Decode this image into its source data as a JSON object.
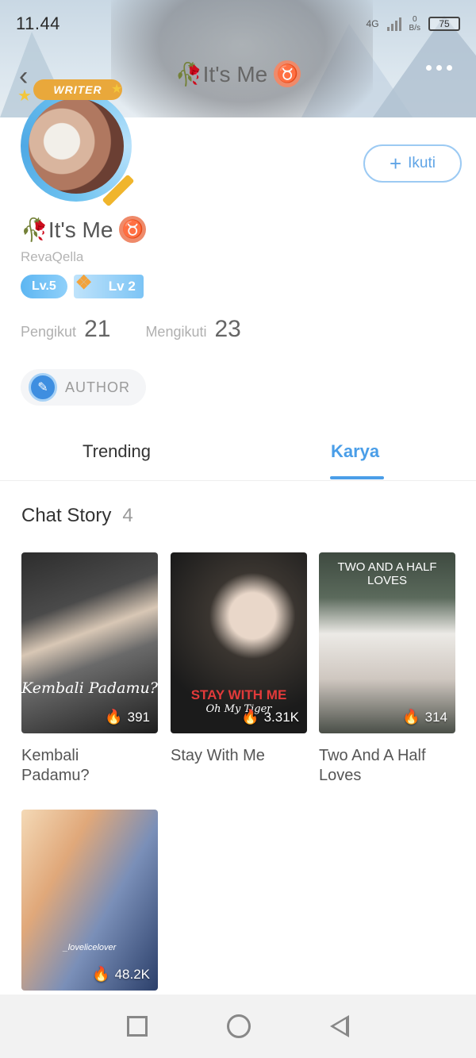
{
  "status_bar": {
    "time": "11.44",
    "network": "4G",
    "speed_value": "0",
    "speed_unit": "B/s",
    "battery": "75"
  },
  "header": {
    "title": "🥀It's Me",
    "zodiac_symbol": "♉",
    "back_icon": "chevron-left-icon",
    "more_icon": "more-dots-icon"
  },
  "profile": {
    "avatar_badge": "WRITER",
    "display_name": "🥀It's Me",
    "zodiac_symbol": "♉",
    "username": "RevaQella",
    "level_1": "Lv.5",
    "level_2": "Lv 2",
    "follow_label": "Ikuti",
    "followers_label": "Pengikut",
    "followers_count": "21",
    "following_label": "Mengikuti",
    "following_count": "23",
    "author_label": "AUTHOR"
  },
  "tabs": [
    {
      "label": "Trending",
      "active": false
    },
    {
      "label": "Karya",
      "active": true
    }
  ],
  "section": {
    "title": "Chat Story",
    "count": "4"
  },
  "stories": [
    {
      "title": "Kembali Padamu?",
      "views": "391",
      "cover_text": "Kembali Padamu?"
    },
    {
      "title": "Stay With Me",
      "views": "3.31K",
      "cover_text": "STAY WITH ME",
      "cover_subtext": "Oh My Tiger"
    },
    {
      "title": "Two And A Half Loves",
      "views": "314",
      "cover_text": "TWO AND A HALF LOVES"
    },
    {
      "title": "",
      "views": "48.2K",
      "cover_text": "_lovelicelover"
    }
  ],
  "colors": {
    "accent": "#4a9ee8",
    "zodiac_bg": "#ef8a6a",
    "writer_badge": "#e9a83b"
  }
}
